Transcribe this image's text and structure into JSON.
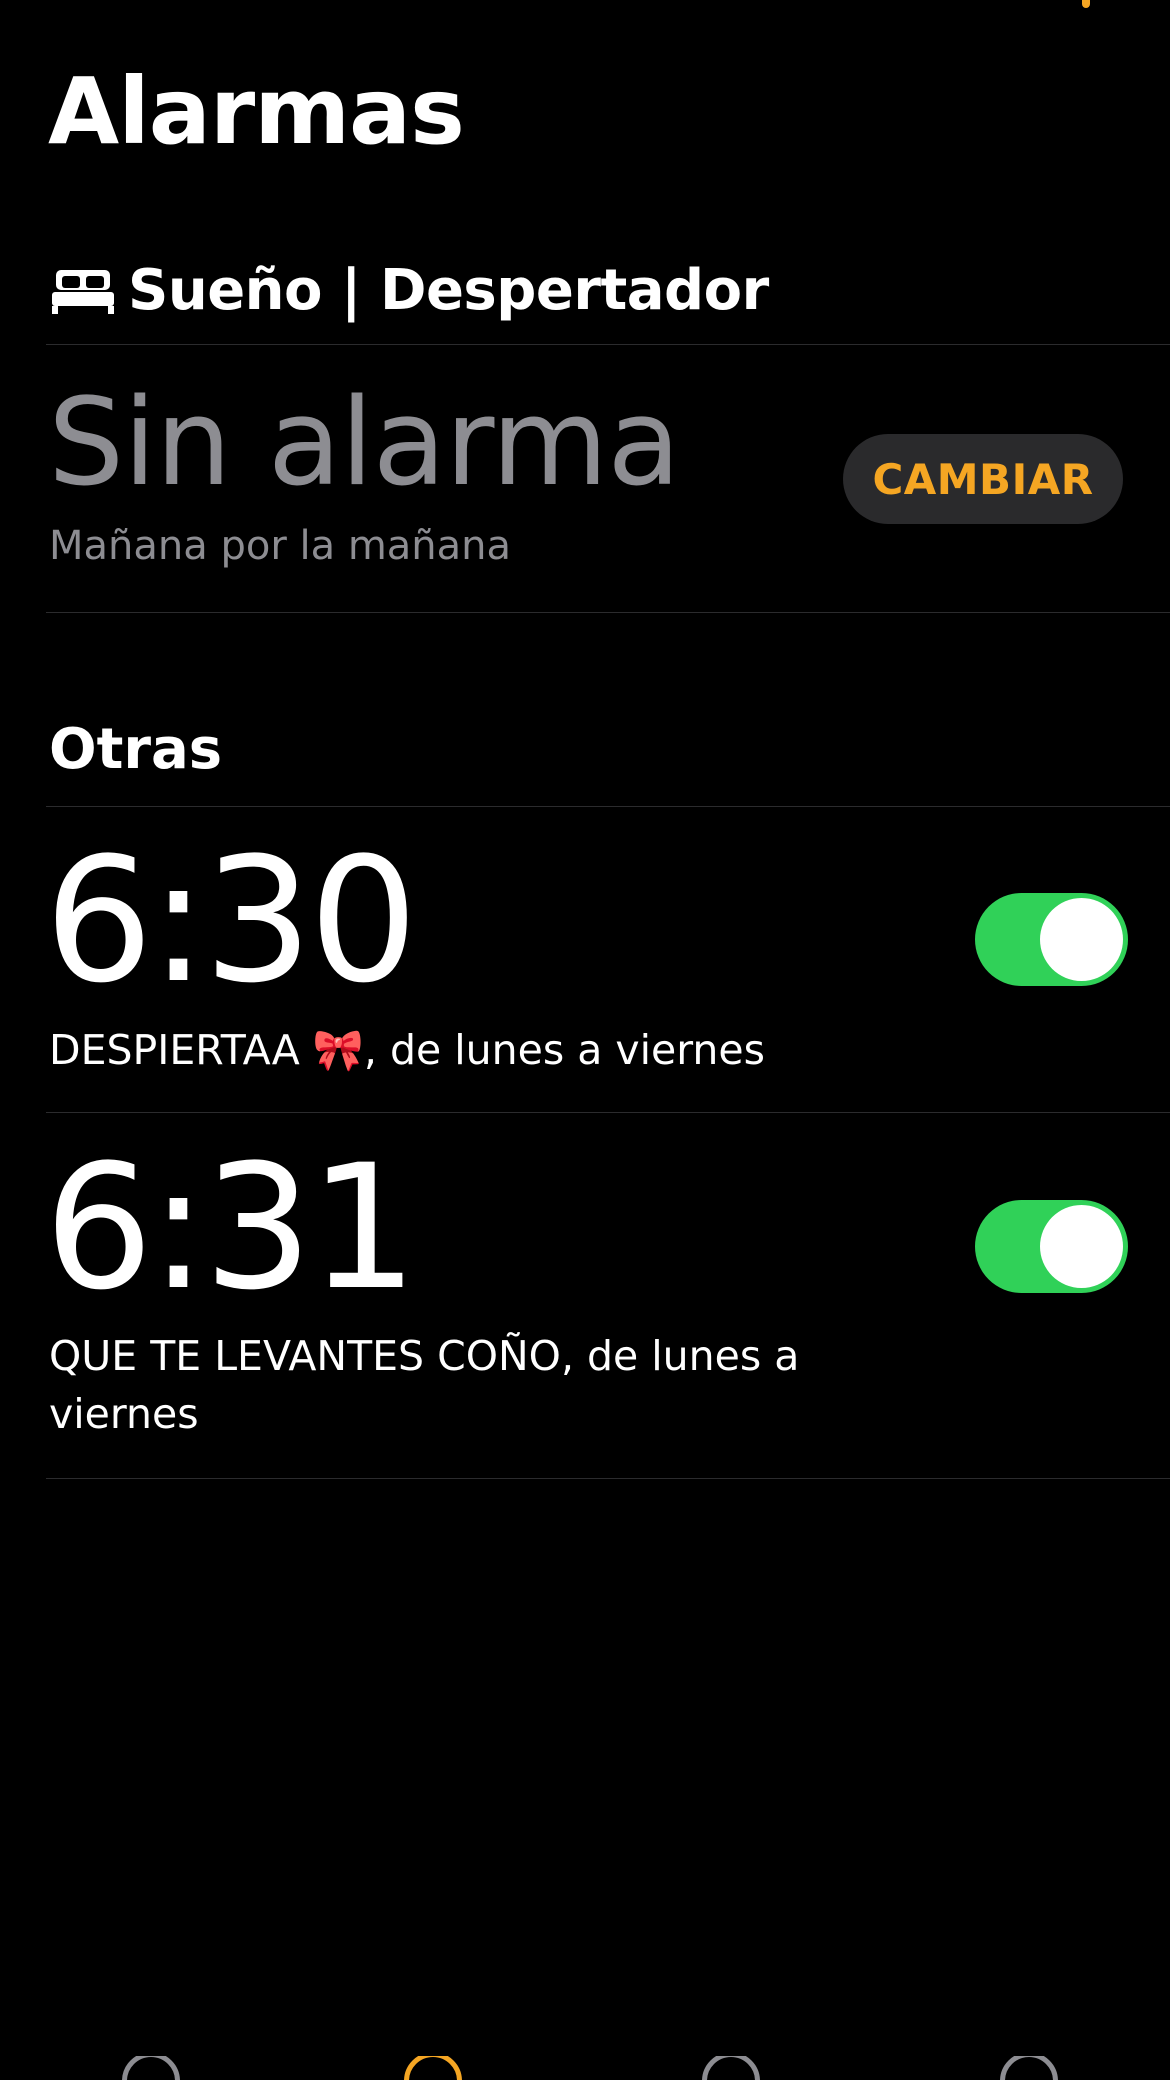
{
  "page": {
    "title": "Alarmas"
  },
  "sleep_section": {
    "header_icon": "bed-icon",
    "header_label": "Sueño | Despertador",
    "time_text": "Sin alarma",
    "subtitle": "Mañana por la mañana",
    "change_label": "CAMBIAR"
  },
  "other_section": {
    "label": "Otras",
    "alarms": [
      {
        "time": "6:30",
        "description": "DESPIERTAA 🎀, de lunes a viernes",
        "enabled": true
      },
      {
        "time": "6:31",
        "description": "QUE TE LEVANTES COÑO, de lunes a viernes",
        "enabled": true
      }
    ]
  },
  "colors": {
    "background": "#000000",
    "accent": "#f5a623",
    "toggle_on": "#30d158",
    "secondary_text": "#8d8d92",
    "separator": "#2b2b2d"
  }
}
